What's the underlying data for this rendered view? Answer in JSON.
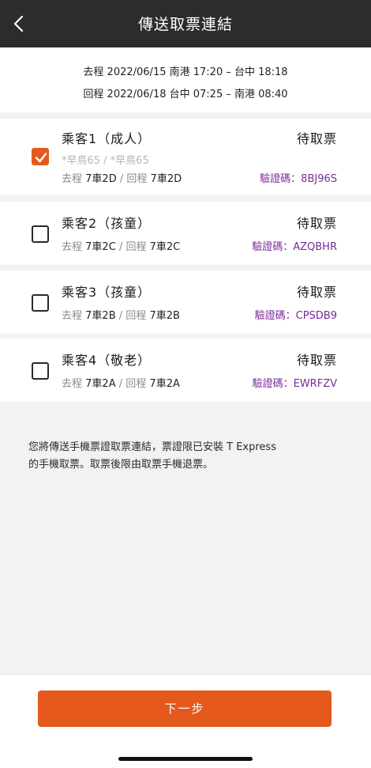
{
  "header": {
    "title": "傳送取票連結"
  },
  "trip": {
    "outbound": "去程 2022/06/15 南港 17:20 – 台中 18:18",
    "return": "回程 2022/06/18 台中 07:25 – 南港 08:40"
  },
  "passengers": [
    {
      "name": "乘客1（成人）",
      "status": "待取票",
      "checked": true,
      "discount": "*早鳥65 / *早鳥65",
      "out_label": "去程",
      "out_seat": "7車2D",
      "sep": "/",
      "ret_label": "回程",
      "ret_seat": "7車2D",
      "verify": "驗證碼：8BJ96S"
    },
    {
      "name": "乘客2（孩童）",
      "status": "待取票",
      "checked": false,
      "out_label": "去程",
      "out_seat": "7車2C",
      "sep": "/",
      "ret_label": "回程",
      "ret_seat": "7車2C",
      "verify": "驗證碼：AZQBHR"
    },
    {
      "name": "乘客3（孩童）",
      "status": "待取票",
      "checked": false,
      "out_label": "去程",
      "out_seat": "7車2B",
      "sep": "/",
      "ret_label": "回程",
      "ret_seat": "7車2B",
      "verify": "驗證碼：CPSDB9"
    },
    {
      "name": "乘客4（敬老）",
      "status": "待取票",
      "checked": false,
      "out_label": "去程",
      "out_seat": "7車2A",
      "sep": "/",
      "ret_label": "回程",
      "ret_seat": "7車2A",
      "verify": "驗證碼：EWRFZV"
    }
  ],
  "notice": {
    "line1": "您將傳送手機票證取票連結，票證限已安裝 T Express",
    "line2": "的手機取票。取票後限由取票手機退票。"
  },
  "footer": {
    "next_label": "下一步"
  },
  "icons": {
    "back": "chevron-left-icon",
    "check": "checkmark-icon"
  },
  "colors": {
    "accent": "#e55a1c",
    "header_bg": "#2c2c2c",
    "verify_code": "#7a2a9a"
  }
}
